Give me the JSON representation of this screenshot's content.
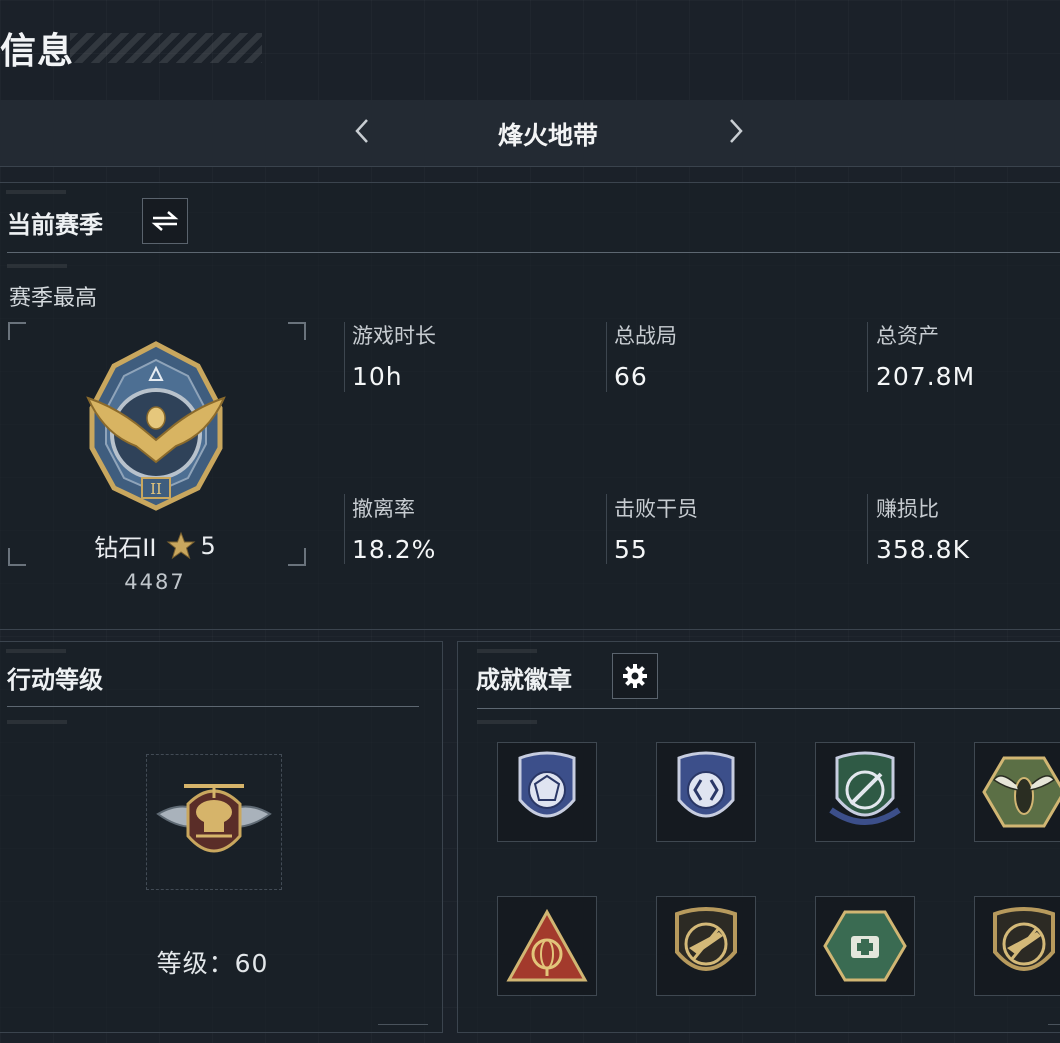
{
  "page": {
    "title": "信息"
  },
  "mode_selector": {
    "title": "烽火地带",
    "prev_icon": "chevron-left-icon",
    "next_icon": "chevron-right-icon"
  },
  "season_panel": {
    "header": "当前赛季",
    "switch_icon": "swap-icon",
    "sub_label": "赛季最高",
    "rank": {
      "name": "钻石II",
      "stars": "5",
      "score": "4487",
      "star_icon": "star-icon",
      "medal_icon": "eagle-medal-icon"
    },
    "stats": [
      {
        "label": "游戏时长",
        "value": "10h"
      },
      {
        "label": "总战局",
        "value": "66"
      },
      {
        "label": "总资产",
        "value": "207.8M"
      },
      {
        "label": "撤离率",
        "value": "18.2%"
      },
      {
        "label": "击败干员",
        "value": "55"
      },
      {
        "label": "赚损比",
        "value": "358.8K"
      }
    ]
  },
  "action_level_panel": {
    "header": "行动等级",
    "level_label": "等级：",
    "level_value": "60",
    "emblem_icon": "helicopter-emblem-icon"
  },
  "achievement_panel": {
    "header": "成就徽章",
    "settings_icon": "gear-icon",
    "badges": [
      {
        "icon": "blue-shield-gem-badge-icon"
      },
      {
        "icon": "blue-shield-arrow-badge-icon"
      },
      {
        "icon": "green-shield-knife-badge-icon"
      },
      {
        "icon": "hexagon-wasp-badge-icon"
      },
      {
        "icon": "red-triangle-gyro-badge-icon"
      },
      {
        "icon": "shield-rifle-badge-icon"
      },
      {
        "icon": "green-hexagon-medkit-badge-icon"
      },
      {
        "icon": "shield-rifle-badge-icon"
      }
    ]
  },
  "colors": {
    "background": "#1b2129",
    "panel_border": "#3b444e",
    "gold": "#c9a75e",
    "blue_steel": "#4d6f93"
  }
}
